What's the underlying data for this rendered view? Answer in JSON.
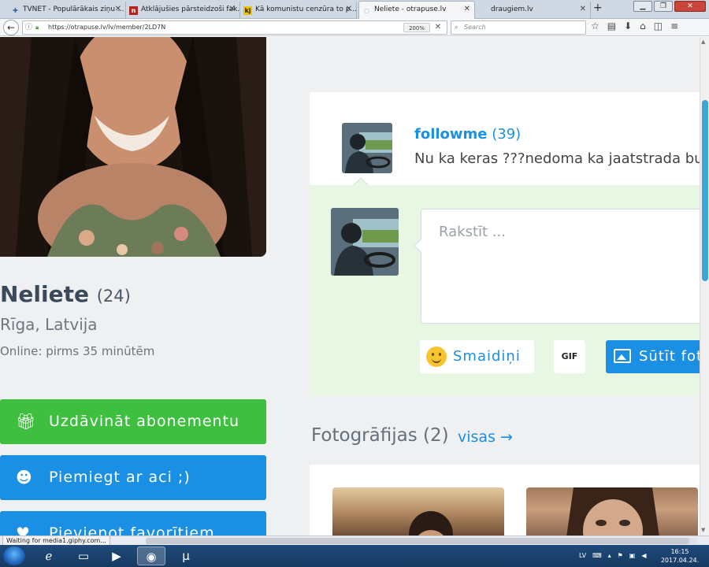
{
  "browser": {
    "tabs": [
      {
        "label": "TVNET - Populārākais ziņu ...",
        "favicon": "tvnet",
        "favicon_color": "#2d5fb5"
      },
      {
        "label": "Atklājušies pārsteidzoši fak...",
        "favicon": "n",
        "favicon_color": "#b3261e"
      },
      {
        "label": "Kā komunistu cenzūra to p...",
        "favicon": "kj",
        "favicon_color": "#f2c200"
      },
      {
        "label": "Neliete - otrapuse.lv",
        "favicon": "loading",
        "favicon_color": "#3c8fd8",
        "active": true
      },
      {
        "label": "draugiem.lv",
        "favicon": "none",
        "favicon_color": ""
      }
    ],
    "url": "https://otrapuse.lv/lv/member/2LD7N",
    "zoom": "200%",
    "search_placeholder": "Search",
    "status": "Waiting for media1.giphy.com..."
  },
  "profile": {
    "name": "Neliete",
    "age": "(24)",
    "location": "Rīga, Latvija",
    "online": "Online: pirms 35 minūtēm",
    "buttons": {
      "gift": "Uzdāvināt abonementu",
      "wink": "Piemiegt ar aci ;)",
      "favorite": "Pievienot favorītiem"
    }
  },
  "message": {
    "author": "followme",
    "author_count": "(39)",
    "text": "Nu ka keras ???nedoma ka jaatstrada butu"
  },
  "compose": {
    "placeholder": "Rakstīt ...",
    "smile_label": "Smaidiņi",
    "gif_label": "GIF",
    "send_label": "Sūtīt foto"
  },
  "photos": {
    "title": "Fotogrāfijas",
    "count": "(2)",
    "view_all": "visas →"
  },
  "taskbar": {
    "language": "LV",
    "time": "16:15",
    "date": "2017.04.24."
  },
  "colors": {
    "accent_blue": "#1a8fe3",
    "accent_green": "#3fbf3f",
    "compose_bg": "#e7f7e3"
  }
}
